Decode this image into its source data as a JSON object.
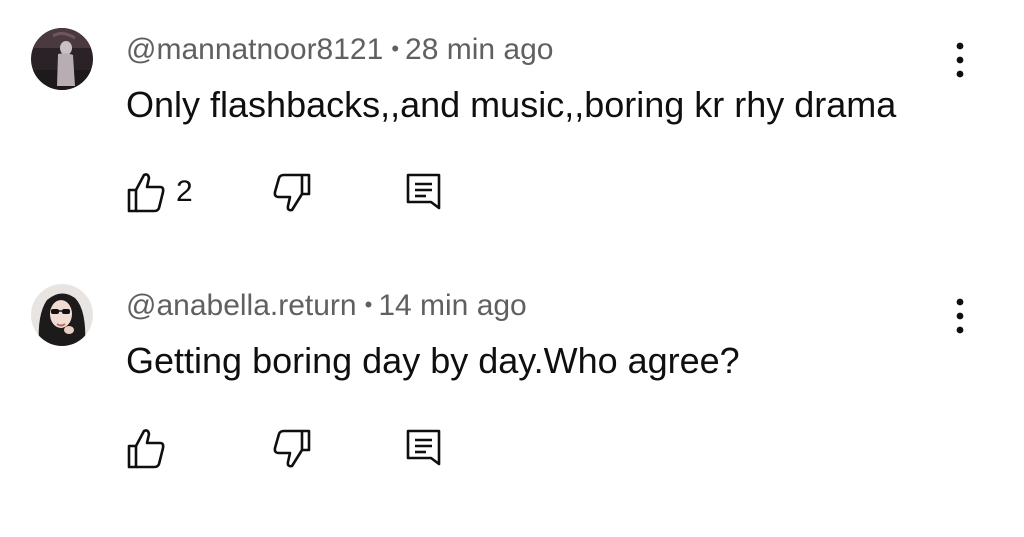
{
  "comments": [
    {
      "author": "@mannatnoor8121",
      "time": "28 min ago",
      "separator": "•",
      "text": "Only flashbacks,,and music,,boring kr rhy drama",
      "likes": "2",
      "avatar": "dark-figure-avatar"
    },
    {
      "author": "@anabella.return",
      "time": "14 min ago",
      "separator": "•",
      "text": "Getting boring day by day.Who agree?",
      "likes": "",
      "avatar": "woman-sunglasses-avatar"
    }
  ],
  "icons": {
    "like": "thumbs-up-icon",
    "dislike": "thumbs-down-icon",
    "reply": "reply-comment-icon",
    "menu": "more-vertical-icon"
  }
}
